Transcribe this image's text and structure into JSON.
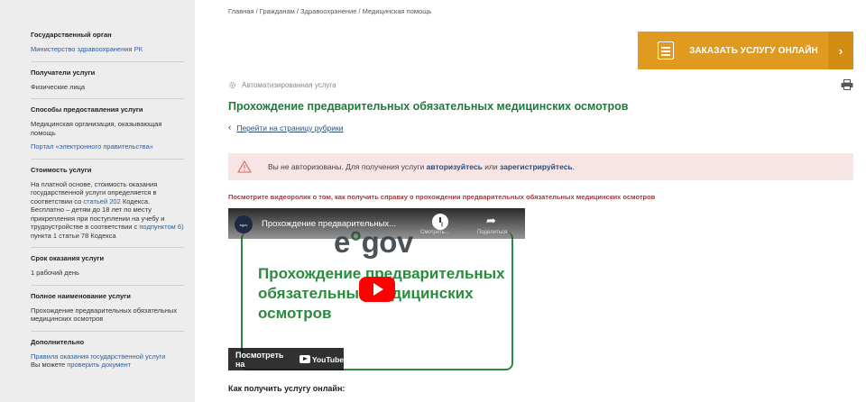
{
  "sidebar": {
    "authority_title": "Государственный орган",
    "authority_value": "Министерство здравоохранения РК",
    "recipients_title": "Получатели услуги",
    "recipients_value": "Физические лица",
    "methods_title": "Способы предоставления услуги",
    "methods_value": "Медицинская организация, оказывающая помощь",
    "methods_link": "Портал «электронного правительства»",
    "cost_title": "Стоимость услуги",
    "cost_text_1": "На платной основе, стоимость оказания государственной услуги определяется в соответствии со",
    "cost_link_1": "статьей 202",
    "cost_text_2": "Кодекса.",
    "cost_text_3": "Бесплатно – детям до 18 лет по месту прикрепления при поступлении на учебу и трудоустройстве в соответствии с",
    "cost_link_2": "подпунктом 6)",
    "cost_text_4": "пункта 1 статьи 78 Кодекса",
    "term_title": "Срок оказания услуги",
    "term_value": "1 рабочий день",
    "fullname_title": "Полное наименование услуги",
    "fullname_value": "Прохождение предварительных обязательных медицинских осмотров",
    "extra_title": "Дополнительно",
    "extra_link": "Правила оказания государственной услуги",
    "extra_text": "Вы можете",
    "extra_link_2": "проверить документ"
  },
  "breadcrumb": "Главная / Гражданам / Здравоохранение / Медицинская помощь",
  "order_button": {
    "label": "ЗАКАЗАТЬ УСЛУГУ ОНЛАЙН",
    "arrow": "›"
  },
  "service_type": "Автоматизированная услуга",
  "page_title": "Прохождение предварительных обязательных медицинских осмотров",
  "back_link": "Перейти на страницу рубрики",
  "alert": {
    "text_1": "Вы не авторизованы. Для получения услуги",
    "link_login": "авторизуйтесь",
    "text_2": "или",
    "link_register": "зарегистрируйтесь",
    "text_3": "."
  },
  "video_caption": "Посмотрите видеоролик о том, как получить справку о прохождении предварительных обязательных медицинских осмотров",
  "video": {
    "title": "Прохождение предварительных...",
    "watch_later": "Смотреть...",
    "share": "Поделиться",
    "logo_e": "e",
    "logo_gov": "gov",
    "headline": "Прохождение предварительных обязательных медицинских осмотров",
    "watch_on": "Посмотреть на",
    "youtube": "YouTube"
  },
  "how_title": "Как получить услугу онлайн:",
  "colors": {
    "green": "#1f7a3a",
    "orange": "#e09a1f",
    "alert_bg": "#f7e4e4",
    "link": "#2a5d9f"
  }
}
